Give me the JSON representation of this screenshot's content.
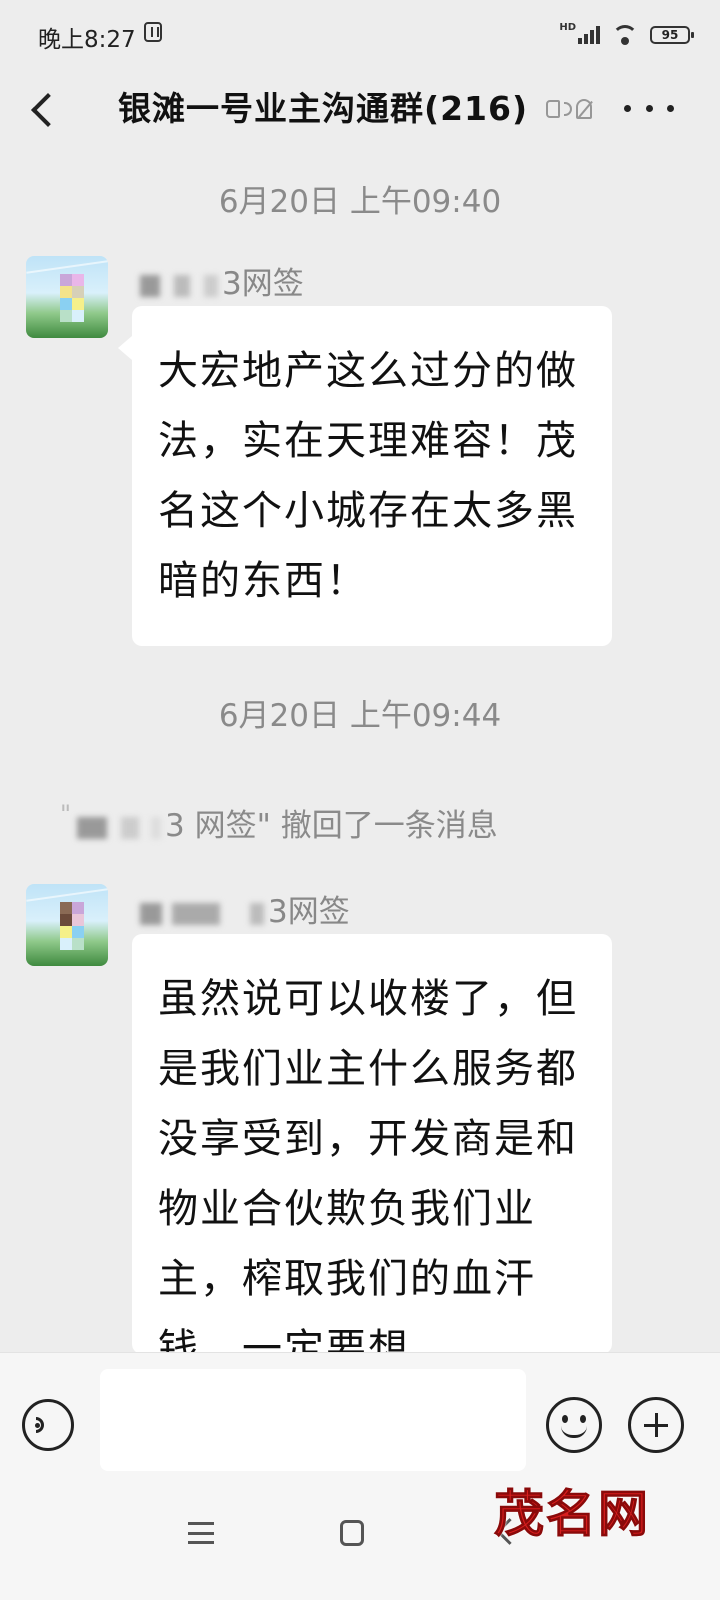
{
  "status_bar": {
    "time": "晚上8:27",
    "network_label": "HD",
    "battery": "95",
    "icons": [
      "nfc-icon",
      "signal-icon",
      "wifi-icon",
      "battery-icon"
    ]
  },
  "header": {
    "title": "银滩一号业主沟通群(216)",
    "icons": [
      "back-icon",
      "mute-icon",
      "more-icon"
    ]
  },
  "messages": [
    {
      "type": "timestamp",
      "text": "6月20日 上午09:40"
    },
    {
      "type": "message",
      "sender_visible": "3网签",
      "text": "大宏地产这么过分的做法，实在天理难容！茂名这个小城存在太多黑暗的东西！"
    },
    {
      "type": "timestamp",
      "text": "6月20日 上午09:44"
    },
    {
      "type": "system",
      "text_visible": "3 网签\" 撤回了一条消息"
    },
    {
      "type": "message",
      "sender_visible": "3网签",
      "text": "虽然说可以收楼了，但是我们业主什么服务都没享受到，开发商是和物业合伙欺负我们业主，榨取我们的血汗钱，一定要想"
    }
  ],
  "input_bar": {
    "icons": [
      "voice-icon",
      "emoji-icon",
      "plus-icon"
    ],
    "text_value": ""
  },
  "system_nav": {
    "icons": [
      "menu-icon",
      "home-icon",
      "back-icon"
    ]
  },
  "watermark": "茂名网",
  "colors": {
    "background": "#ededed",
    "bubble": "#ffffff",
    "timestamp_text": "#8a8a8a",
    "watermark": "#d81e1e"
  }
}
